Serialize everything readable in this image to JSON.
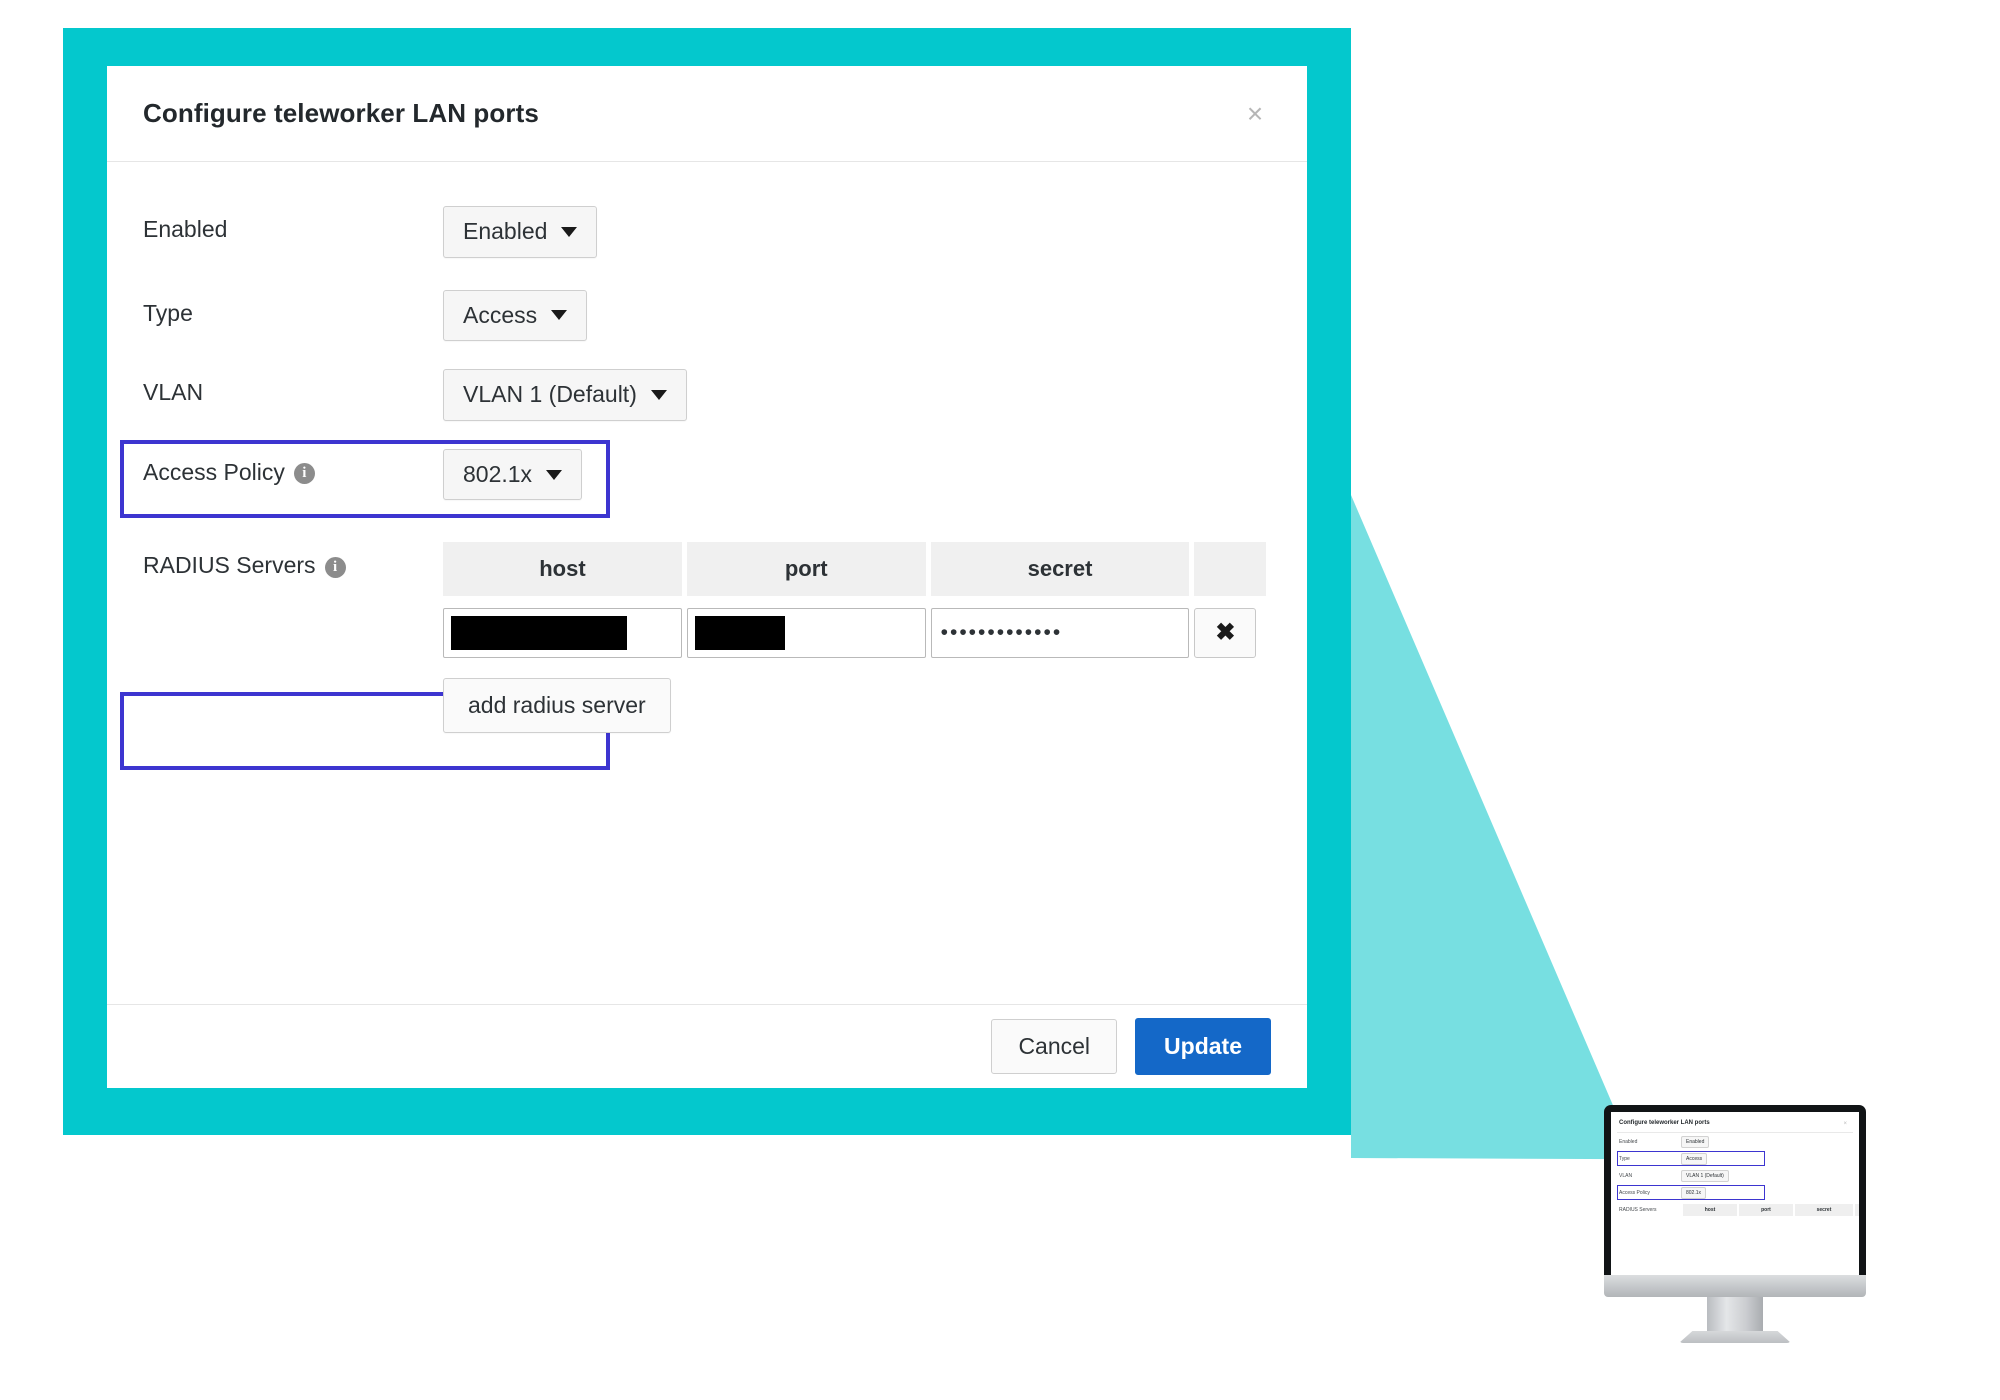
{
  "colors": {
    "teal_frame": "#04C8CD",
    "connector_triangle": "#5FD9DC",
    "highlight_outline": "#3D35D0",
    "primary_button": "#1468C8"
  },
  "dialog": {
    "title": "Configure teleworker LAN ports",
    "close_label": "×",
    "rows": {
      "enabled": {
        "label": "Enabled",
        "value": "Enabled"
      },
      "type": {
        "label": "Type",
        "value": "Access",
        "highlighted": true
      },
      "vlan": {
        "label": "VLAN",
        "value": "VLAN 1 (Default)"
      },
      "access_policy": {
        "label": "Access Policy",
        "info_glyph": "i",
        "value": "802.1x",
        "highlighted": true
      },
      "radius": {
        "label": "RADIUS Servers",
        "info_glyph": "i",
        "headers": {
          "host": "host",
          "port": "port",
          "secret": "secret",
          "actions": ""
        },
        "server_row": {
          "host": "",
          "port": "",
          "secret": "•••••••••••••",
          "delete_label": "✖"
        },
        "add_label": "add radius server"
      }
    },
    "footer": {
      "cancel_label": "Cancel",
      "update_label": "Update"
    }
  },
  "thumbnail": {
    "title": "Configure teleworker LAN ports",
    "close_label": "×",
    "rows": {
      "enabled": {
        "label": "Enabled",
        "value": "Enabled"
      },
      "type": {
        "label": "Type",
        "value": "Access"
      },
      "vlan": {
        "label": "VLAN",
        "value": "VLAN 1 (Default)"
      },
      "access_policy": {
        "label": "Access Policy",
        "value": "802.1x"
      },
      "radius": {
        "label": "RADIUS Servers",
        "headers": {
          "host": "host",
          "port": "port",
          "secret": "secret"
        }
      }
    }
  }
}
